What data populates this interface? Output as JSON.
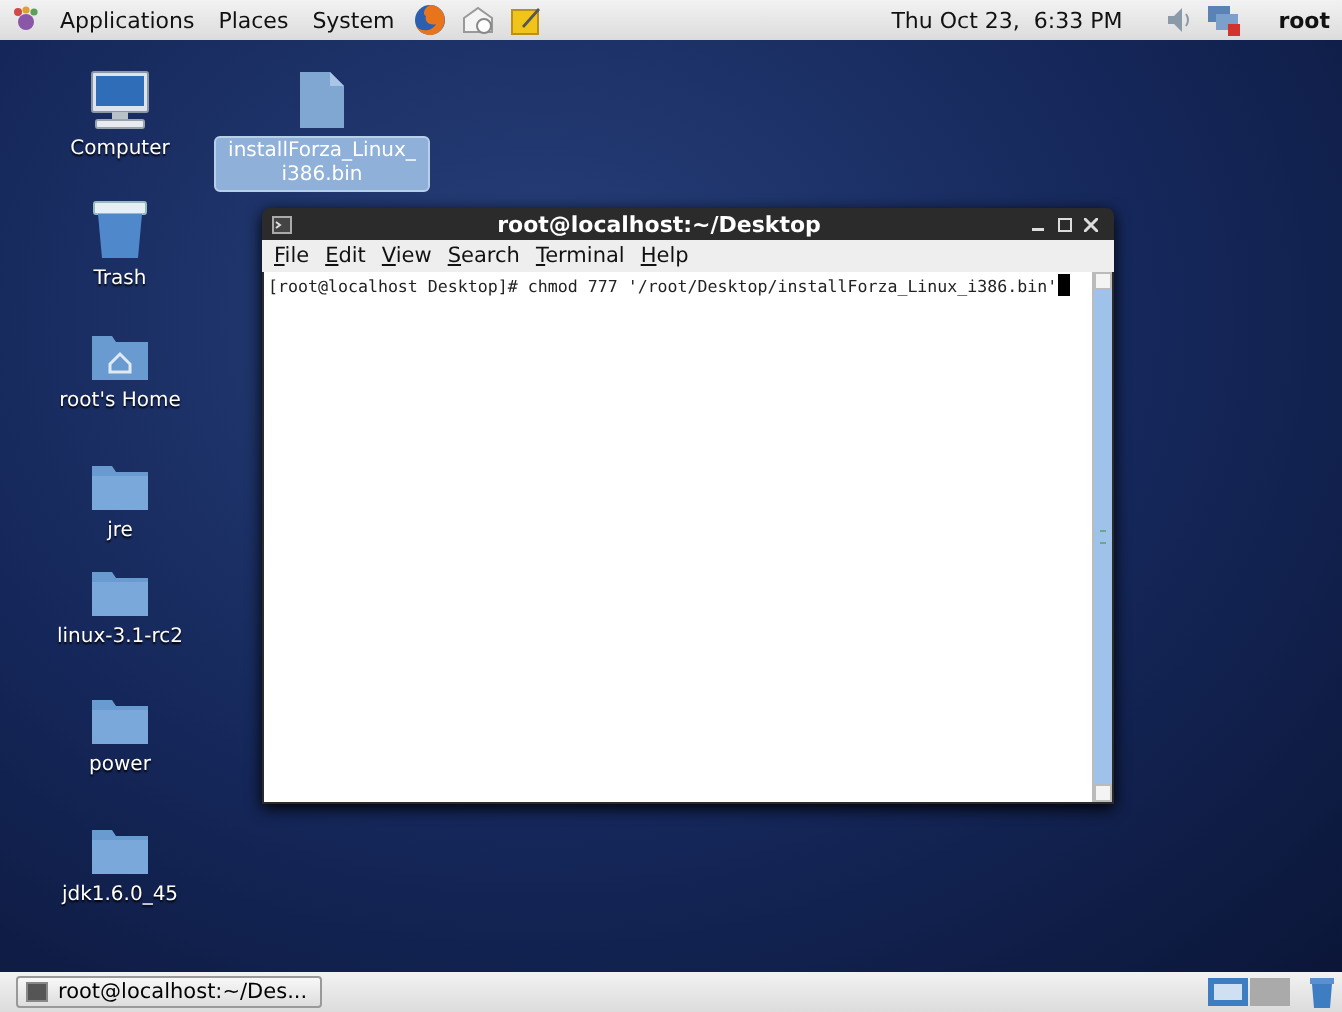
{
  "top_panel": {
    "menus": [
      "Applications",
      "Places",
      "System"
    ],
    "clock": "Thu Oct 23,  6:33 PM",
    "user": "root"
  },
  "desktop_icons": [
    {
      "kind": "computer",
      "label": "Computer",
      "selected": false
    },
    {
      "kind": "file",
      "label": "installForza_Linux_ i386.bin",
      "selected": true
    },
    {
      "kind": "trash",
      "label": "Trash",
      "selected": false
    },
    {
      "kind": "home",
      "label": "root's Home",
      "selected": false
    },
    {
      "kind": "folder",
      "label": "jre",
      "selected": false
    },
    {
      "kind": "folder",
      "label": "linux-3.1-rc2",
      "selected": false
    },
    {
      "kind": "folder",
      "label": "power",
      "selected": false
    },
    {
      "kind": "folder",
      "label": "jdk1.6.0_45",
      "selected": false
    }
  ],
  "terminal": {
    "title": "root@localhost:~/Desktop",
    "menu": [
      "File",
      "Edit",
      "View",
      "Search",
      "Terminal",
      "Help"
    ],
    "lines": [
      "[root@localhost Desktop]# chmod 777 '/root/Desktop/installForza_Linux_i386.bin'"
    ]
  },
  "bottom_panel": {
    "tasks": [
      {
        "label": "root@localhost:~/Des...",
        "selected": false
      }
    ],
    "workspaces": [
      {
        "selected": true
      },
      {
        "selected": false
      }
    ]
  }
}
